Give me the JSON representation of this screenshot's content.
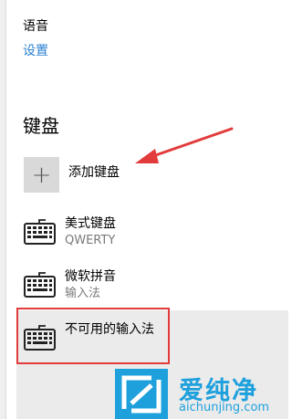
{
  "language": {
    "label": "语音",
    "settings_link": "设置"
  },
  "keyboards": {
    "heading": "键盘",
    "add_label": "添加键盘",
    "add_symbol": "+",
    "items": [
      {
        "name": "美式键盘",
        "sub": "QWERTY",
        "icon": "keyboard-icon"
      },
      {
        "name": "微软拼音",
        "sub": "输入法",
        "icon": "keyboard-icon"
      },
      {
        "name": "不可用的输入法",
        "sub": "",
        "icon": "keyboard-icon"
      }
    ]
  },
  "watermark": {
    "title": "爱纯净",
    "url": "aichunjing.com",
    "color": "#1ea0dc"
  },
  "colors": {
    "link": "#2b80d1",
    "annotation": "#e23b3b"
  }
}
